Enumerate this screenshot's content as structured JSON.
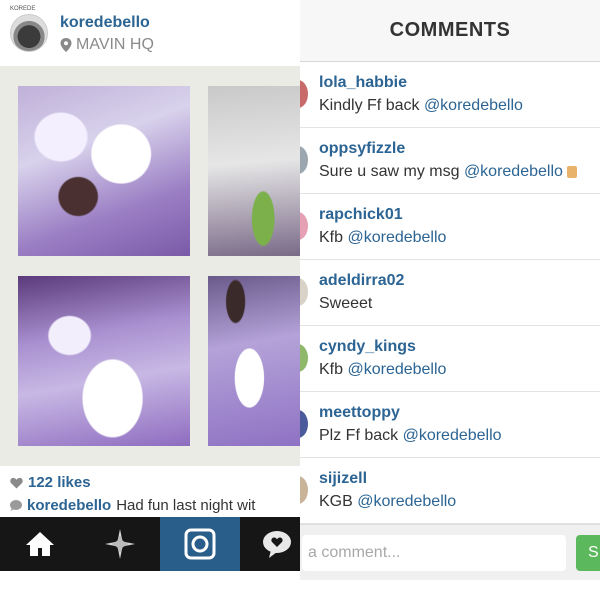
{
  "post": {
    "avatar_tag": "KOREDE",
    "username": "koredebello",
    "location": "MAVIN HQ",
    "likes": "122 likes",
    "caption_user": "koredebello",
    "caption_text": "Had fun last night wit"
  },
  "tabbar": {
    "icons": [
      "home-icon",
      "explore-icon",
      "camera-icon",
      "activity-icon"
    ]
  },
  "comments_panel": {
    "title": "COMMENTS",
    "comments": [
      {
        "user": "lola_habbie",
        "text": "Kindly Ff back ",
        "mention": "@koredebello"
      },
      {
        "user": "oppsyfizzle",
        "text": "Sure u saw my msg ",
        "mention": "@koredebello"
      },
      {
        "user": "rapchick01",
        "text": "Kfb ",
        "mention": "@koredebello"
      },
      {
        "user": "adeldirra02",
        "text": "Sweeet",
        "mention": ""
      },
      {
        "user": "cyndy_kings",
        "text": "Kfb ",
        "mention": "@koredebello"
      },
      {
        "user": "meettoppy",
        "text": "Plz Ff back ",
        "mention": "@koredebello"
      },
      {
        "user": "sijizell",
        "text": "KGB ",
        "mention": "@koredebello"
      }
    ],
    "input_placeholder": "a comment...",
    "send_label": "S"
  },
  "colors": {
    "link_blue": "#2c6493",
    "tabbar_bg": "#161616",
    "tab_active": "#2a5e8a",
    "send_green": "#5cb85c"
  }
}
